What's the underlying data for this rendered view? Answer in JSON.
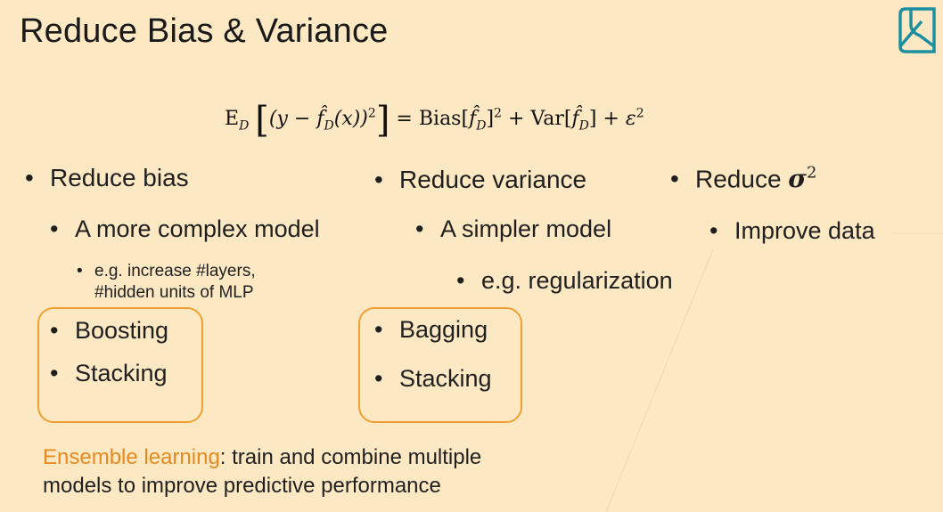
{
  "title": "Reduce Bias & Variance",
  "logo_icon": "book-logo-icon",
  "formula": {
    "lhs_E": "E",
    "lhs_sub": "D",
    "lhs_inner_a": "(y − ",
    "lhs_fhat": "f̂",
    "lhs_inner_b": "(x))",
    "lhs_exp": "2",
    "equals": "=",
    "bias": "Bias[",
    "bias_close": "]",
    "plus1": "+",
    "var": "Var[",
    "var_close": "]",
    "plus2": "+",
    "epsilon": "ε",
    "eps_exp": "2"
  },
  "columns": {
    "bias": {
      "heading": "Reduce bias",
      "item1": "A more complex model",
      "sub1_line1": "e.g. increase #layers,",
      "sub1_line2": "#hidden units of MLP",
      "method1": "Boosting",
      "method2": "Stacking"
    },
    "variance": {
      "heading": "Reduce variance",
      "item1": "A simpler model",
      "sub1": "e.g. regularization",
      "method1": "Bagging",
      "method2": "Stacking"
    },
    "noise": {
      "heading": "Reduce",
      "sigma": "σ",
      "sigma_exp": "2",
      "item1": "Improve data"
    }
  },
  "bullet_char": "•",
  "footer": {
    "accent": "Ensemble learning",
    "text1": ": train and combine multiple",
    "text2": "models to improve predictive performance"
  },
  "colors": {
    "background": "#fde8c4",
    "accent": "#e68a1f",
    "box_border": "#f0a030",
    "logo": "#1c8fa0"
  }
}
